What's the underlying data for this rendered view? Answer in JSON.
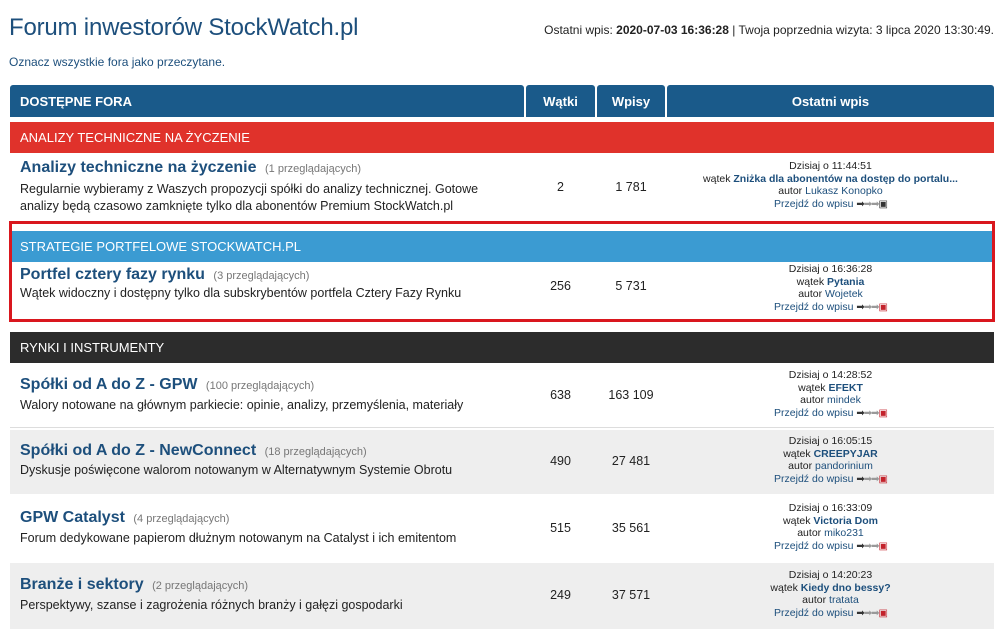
{
  "header": {
    "title": "Forum inwestorów StockWatch.pl",
    "last_post_label": "Ostatni wpis:",
    "last_post_value": "2020-07-03 16:36:28",
    "prev_visit": "| Twoja poprzednia wizyta: 3 lipca 2020 13:30:49."
  },
  "mark_read": "Oznacz wszystkie fora jako przeczytane.",
  "table_head": {
    "name": "DOSTĘPNE FORA",
    "topics": "Wątki",
    "posts": "Wpisy",
    "last": "Ostatni wpis"
  },
  "colors": {
    "header_blue": "#1a5a8a",
    "cat_red": "#e0322b",
    "cat_blue": "#3b9bd2",
    "cat_dark": "#2c2c2c",
    "link_blue": "#1d4f7c",
    "highlight_red": "#d9171e"
  },
  "categories": [
    {
      "name": "ANALIZY TECHNICZNE NA ŻYCZENIE"
    },
    {
      "name": "STRATEGIE PORTFELOWE STOCKWATCH.PL"
    },
    {
      "name": "RYNKI I INSTRUMENTY"
    }
  ],
  "goto_label": "Przejdź do wpisu",
  "topic_prefix": "wątek",
  "author_prefix": "autor",
  "forums": [
    {
      "name": "Analizy techniczne na życzenie",
      "viewers": "(1 przeglądających)",
      "desc": "Regularnie wybieramy z Waszych propozycji spółki do analizy technicznej. Gotowe analizy będą czasowo zamknięte tylko dla abonentów Premium StockWatch.pl",
      "topics": "2",
      "posts": "1 781",
      "last_date": "Dzisiaj o 11:44:51",
      "last_topic": "Zniżka dla abonentów na dostęp do portalu...",
      "last_author": "Lukasz Konopko"
    },
    {
      "name": "Portfel cztery fazy rynku",
      "viewers": "(3 przeglądających)",
      "desc": "Wątek widoczny i dostępny tylko dla subskrybentów portfela Cztery Fazy Rynku",
      "topics": "256",
      "posts": "5 731",
      "last_date": "Dzisiaj o 16:36:28",
      "last_topic": "Pytania",
      "last_author": "Wojetek"
    },
    {
      "name": "Spółki od A do Z - GPW",
      "viewers": "(100 przeglądających)",
      "desc": "Walory notowane na głównym parkiecie: opinie, analizy, przemyślenia, materiały",
      "topics": "638",
      "posts": "163 109",
      "last_date": "Dzisiaj o 14:28:52",
      "last_topic": "EFEKT",
      "last_author": "mindek"
    },
    {
      "name": "Spółki od A do Z - NewConnect",
      "viewers": "(18 przeglądających)",
      "desc": "Dyskusje poświęcone walorom notowanym w Alternatywnym Systemie Obrotu",
      "topics": "490",
      "posts": "27 481",
      "last_date": "Dzisiaj o 16:05:15",
      "last_topic": "CREEPYJAR",
      "last_author": "pandorinium"
    },
    {
      "name": "GPW Catalyst",
      "viewers": "(4 przeglądających)",
      "desc": "Forum dedykowane papierom dłużnym notowanym na Catalyst i ich emitentom",
      "topics": "515",
      "posts": "35 561",
      "last_date": "Dzisiaj o 16:33:09",
      "last_topic": "Victoria Dom",
      "last_author": "miko231"
    },
    {
      "name": "Branże i sektory",
      "viewers": "(2 przeglądających)",
      "desc": "Perspektywy, szanse i zagrożenia różnych branży i gałęzi gospodarki",
      "topics": "249",
      "posts": "37 571",
      "last_date": "Dzisiaj o 14:20:23",
      "last_topic": "Kiedy dno bessy?",
      "last_author": "tratata"
    }
  ]
}
